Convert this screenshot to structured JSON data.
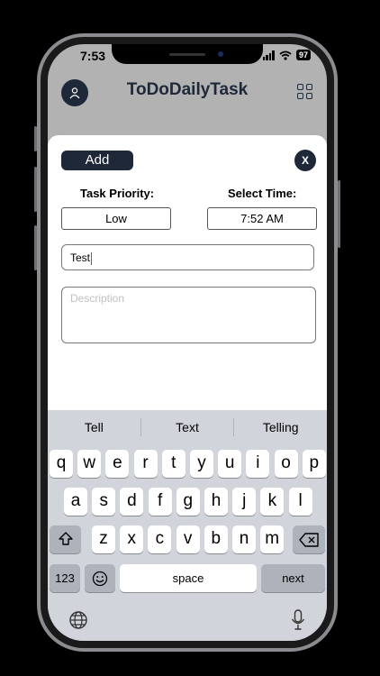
{
  "status_bar": {
    "time": "7:53",
    "battery": "97",
    "icons": [
      "signal-icon",
      "wifi-icon",
      "battery-icon"
    ]
  },
  "header": {
    "title": "ToDoDailyTask",
    "avatar_icon": "user-icon",
    "menu_icon": "grid-icon"
  },
  "sheet": {
    "add_label": "Add",
    "close_label": "X",
    "priority_label": "Task Priority:",
    "priority_value": "Low",
    "time_label": "Select Time:",
    "time_value": "7:52 AM",
    "title_value": "Test",
    "description_placeholder": "Description"
  },
  "keyboard": {
    "suggestions": [
      "Tell",
      "Text",
      "Telling"
    ],
    "row1": [
      "q",
      "w",
      "e",
      "r",
      "t",
      "y",
      "u",
      "i",
      "o",
      "p"
    ],
    "row2": [
      "a",
      "s",
      "d",
      "f",
      "g",
      "h",
      "j",
      "k",
      "l"
    ],
    "row3": [
      "z",
      "x",
      "c",
      "v",
      "b",
      "n",
      "m"
    ],
    "numbers_label": "123",
    "space_label": "space",
    "next_label": "next"
  },
  "colors": {
    "primary": "#1e2838",
    "header_bg": "#b2b2b2",
    "keyboard_bg": "#d1d4da",
    "caret": "#2a6cf5"
  }
}
